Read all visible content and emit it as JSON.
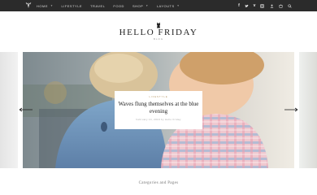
{
  "nav": {
    "items": [
      {
        "label": "HOME",
        "has_dropdown": true
      },
      {
        "label": "LIFESTYLE",
        "has_dropdown": false
      },
      {
        "label": "TRAVEL",
        "has_dropdown": false
      },
      {
        "label": "FOOD",
        "has_dropdown": false
      },
      {
        "label": "SHOP",
        "has_dropdown": true
      },
      {
        "label": "LAYOUTS",
        "has_dropdown": true
      }
    ],
    "social_icons": [
      "facebook-icon",
      "twitter-icon",
      "vimeo-icon",
      "instagram-icon"
    ],
    "utility_icons": [
      "user-icon",
      "cart-icon",
      "search-icon"
    ]
  },
  "brand": {
    "title": "HELLO FRIDAY",
    "tagline": "BLOG"
  },
  "slider": {
    "caption": {
      "category": "LIFESTYLE",
      "title": "Waves flung themselves at the blue evening",
      "meta": "February 14, 2019 by Hello Friday"
    }
  },
  "section": {
    "heading": "Categories and Pages"
  },
  "colors": {
    "topbar": "#2b2b2b",
    "accent": "#b89b6b"
  }
}
